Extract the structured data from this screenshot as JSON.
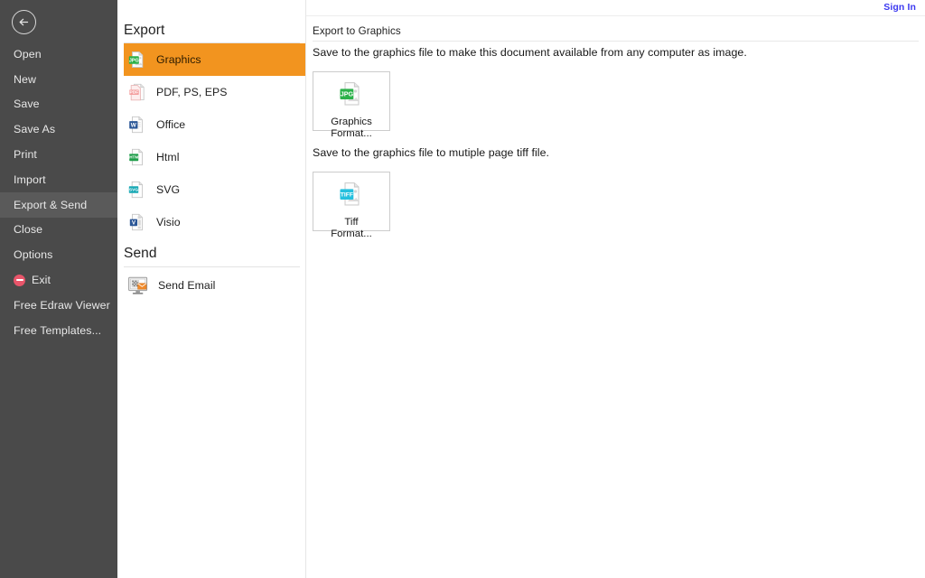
{
  "sidebar": {
    "back_button": "back-arrow-icon",
    "items": [
      {
        "label": "Open",
        "icon": null,
        "active": false
      },
      {
        "label": "New",
        "icon": null,
        "active": false
      },
      {
        "label": "Save",
        "icon": null,
        "active": false
      },
      {
        "label": "Save As",
        "icon": null,
        "active": false
      },
      {
        "label": "Print",
        "icon": null,
        "active": false
      },
      {
        "label": "Import",
        "icon": null,
        "active": false
      },
      {
        "label": "Export & Send",
        "icon": null,
        "active": true
      },
      {
        "label": "Close",
        "icon": null,
        "active": false
      },
      {
        "label": "Options",
        "icon": null,
        "active": false
      },
      {
        "label": "Exit",
        "icon": "exit-icon",
        "active": false
      },
      {
        "label": "Free Edraw Viewer",
        "icon": null,
        "active": false
      },
      {
        "label": "Free Templates...",
        "icon": null,
        "active": false
      }
    ]
  },
  "midpanel": {
    "export_heading": "Export",
    "send_heading": "Send",
    "export_items": [
      {
        "label": "Graphics",
        "icon": "jpg-file-icon",
        "selected": true
      },
      {
        "label": "PDF, PS, EPS",
        "icon": "pdf-file-icon",
        "selected": false
      },
      {
        "label": "Office",
        "icon": "word-file-icon",
        "selected": false
      },
      {
        "label": "Html",
        "icon": "html-file-icon",
        "selected": false
      },
      {
        "label": "SVG",
        "icon": "svg-file-icon",
        "selected": false
      },
      {
        "label": "Visio",
        "icon": "visio-file-icon",
        "selected": false
      }
    ],
    "send_items": [
      {
        "label": "Send Email",
        "icon": "send-email-icon",
        "selected": false
      }
    ]
  },
  "content": {
    "sign_in": "Sign In",
    "title": "Export to Graphics",
    "desc_graphics": "Save to the graphics file to make this document available from any computer as image.",
    "desc_tiff": "Save to the graphics file to mutiple page tiff file.",
    "graphics_button": {
      "line1": "Graphics",
      "line2": "Format...",
      "icon": "jpg-file-icon"
    },
    "tiff_button": {
      "line1": "Tiff",
      "line2": "Format...",
      "icon": "tiff-file-icon"
    }
  },
  "colors": {
    "sidebar_bg": "#4a4a4a",
    "sidebar_active": "#5a5a5a",
    "accent_orange": "#f2941f",
    "signin_blue": "#3b38f0",
    "exit_red": "#e8556a"
  }
}
